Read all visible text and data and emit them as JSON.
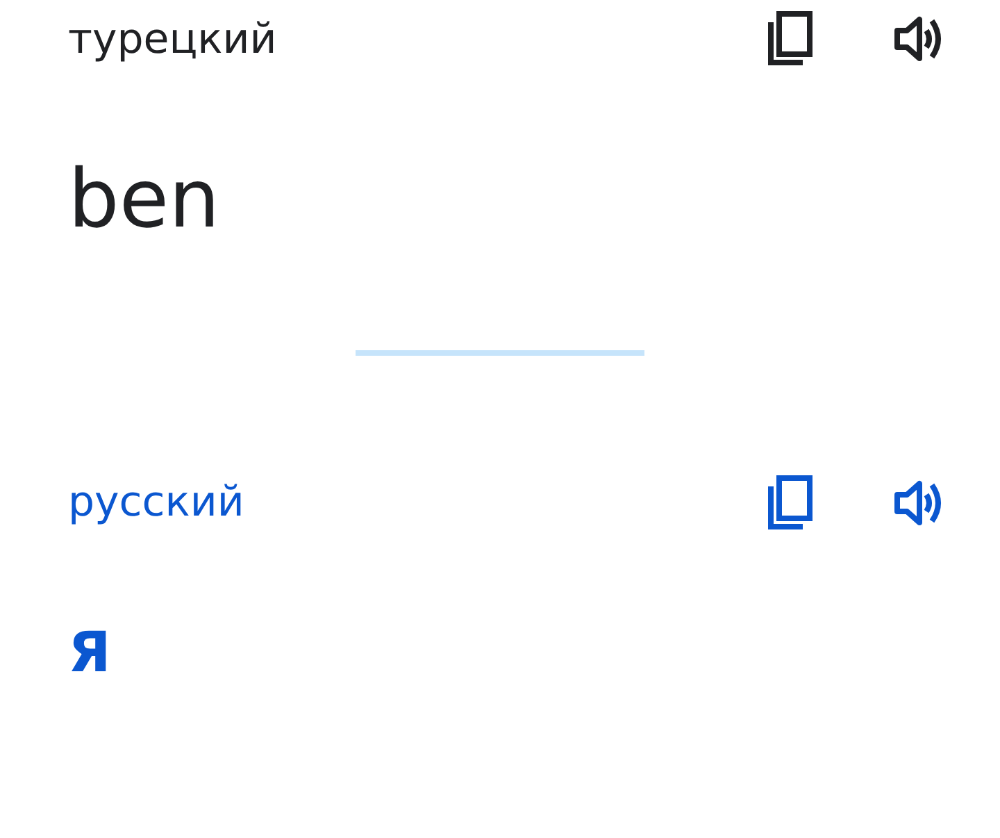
{
  "panels": [
    {
      "kind": "source",
      "language": "турецкий",
      "text": "ben"
    },
    {
      "kind": "target",
      "language": "русский",
      "text": "Я"
    }
  ]
}
